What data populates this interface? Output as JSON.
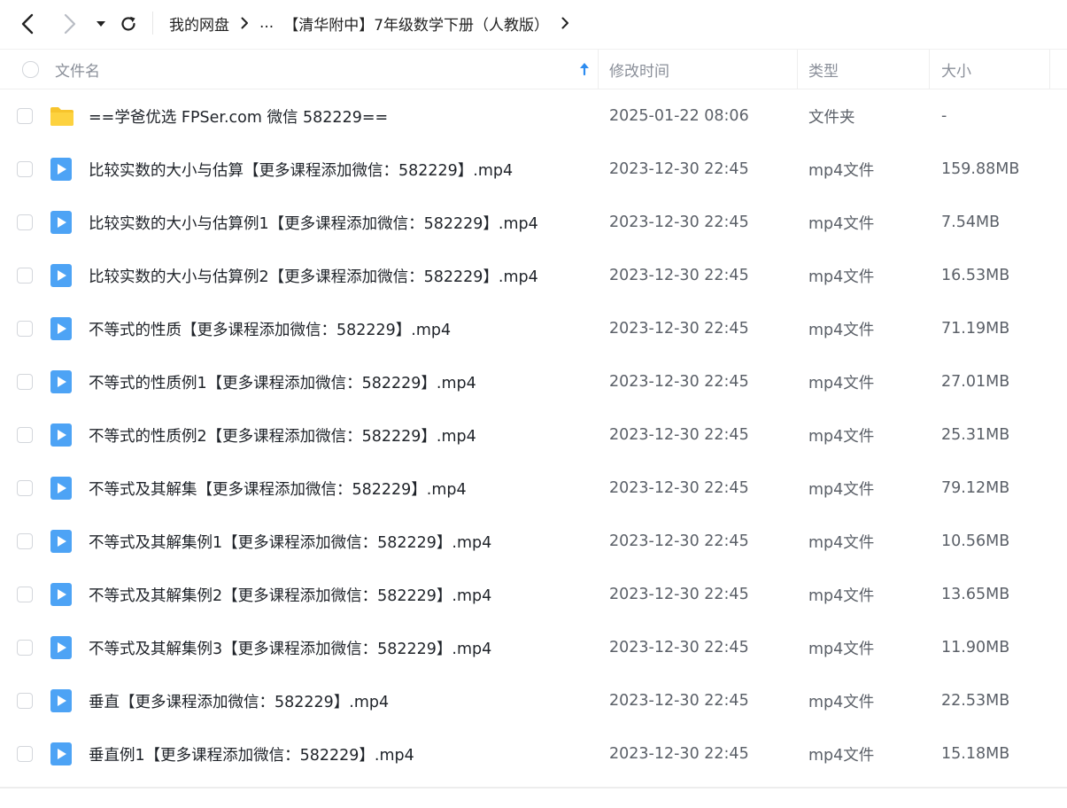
{
  "breadcrumb": {
    "root": "我的网盘",
    "ellipsis": "...",
    "current": "【清华附中】7年级数学下册（人教版）"
  },
  "header": {
    "name": "文件名",
    "modified": "修改时间",
    "type": "类型",
    "size": "大小"
  },
  "colors": {
    "accent": "#2d8cf0",
    "folder": "#f7c42c",
    "video_icon": "#4da3f5"
  },
  "files": [
    {
      "icon": "folder-icon",
      "name": "==学爸优选 FPSer.com 微信 582229==",
      "modified": "2025-01-22 08:06",
      "type": "文件夹",
      "size": "-"
    },
    {
      "icon": "video-file-icon",
      "name": "比较实数的大小与估算【更多课程添加微信：582229】.mp4",
      "modified": "2023-12-30 22:45",
      "type": "mp4文件",
      "size": "159.88MB"
    },
    {
      "icon": "video-file-icon",
      "name": "比较实数的大小与估算例1【更多课程添加微信：582229】.mp4",
      "modified": "2023-12-30 22:45",
      "type": "mp4文件",
      "size": "7.54MB"
    },
    {
      "icon": "video-file-icon",
      "name": "比较实数的大小与估算例2【更多课程添加微信：582229】.mp4",
      "modified": "2023-12-30 22:45",
      "type": "mp4文件",
      "size": "16.53MB"
    },
    {
      "icon": "video-file-icon",
      "name": "不等式的性质【更多课程添加微信：582229】.mp4",
      "modified": "2023-12-30 22:45",
      "type": "mp4文件",
      "size": "71.19MB"
    },
    {
      "icon": "video-file-icon",
      "name": "不等式的性质例1【更多课程添加微信：582229】.mp4",
      "modified": "2023-12-30 22:45",
      "type": "mp4文件",
      "size": "27.01MB"
    },
    {
      "icon": "video-file-icon",
      "name": "不等式的性质例2【更多课程添加微信：582229】.mp4",
      "modified": "2023-12-30 22:45",
      "type": "mp4文件",
      "size": "25.31MB"
    },
    {
      "icon": "video-file-icon",
      "name": "不等式及其解集【更多课程添加微信：582229】.mp4",
      "modified": "2023-12-30 22:45",
      "type": "mp4文件",
      "size": "79.12MB"
    },
    {
      "icon": "video-file-icon",
      "name": "不等式及其解集例1【更多课程添加微信：582229】.mp4",
      "modified": "2023-12-30 22:45",
      "type": "mp4文件",
      "size": "10.56MB"
    },
    {
      "icon": "video-file-icon",
      "name": "不等式及其解集例2【更多课程添加微信：582229】.mp4",
      "modified": "2023-12-30 22:45",
      "type": "mp4文件",
      "size": "13.65MB"
    },
    {
      "icon": "video-file-icon",
      "name": "不等式及其解集例3【更多课程添加微信：582229】.mp4",
      "modified": "2023-12-30 22:45",
      "type": "mp4文件",
      "size": "11.90MB"
    },
    {
      "icon": "video-file-icon",
      "name": "垂直【更多课程添加微信：582229】.mp4",
      "modified": "2023-12-30 22:45",
      "type": "mp4文件",
      "size": "22.53MB"
    },
    {
      "icon": "video-file-icon",
      "name": "垂直例1【更多课程添加微信：582229】.mp4",
      "modified": "2023-12-30 22:45",
      "type": "mp4文件",
      "size": "15.18MB"
    }
  ]
}
